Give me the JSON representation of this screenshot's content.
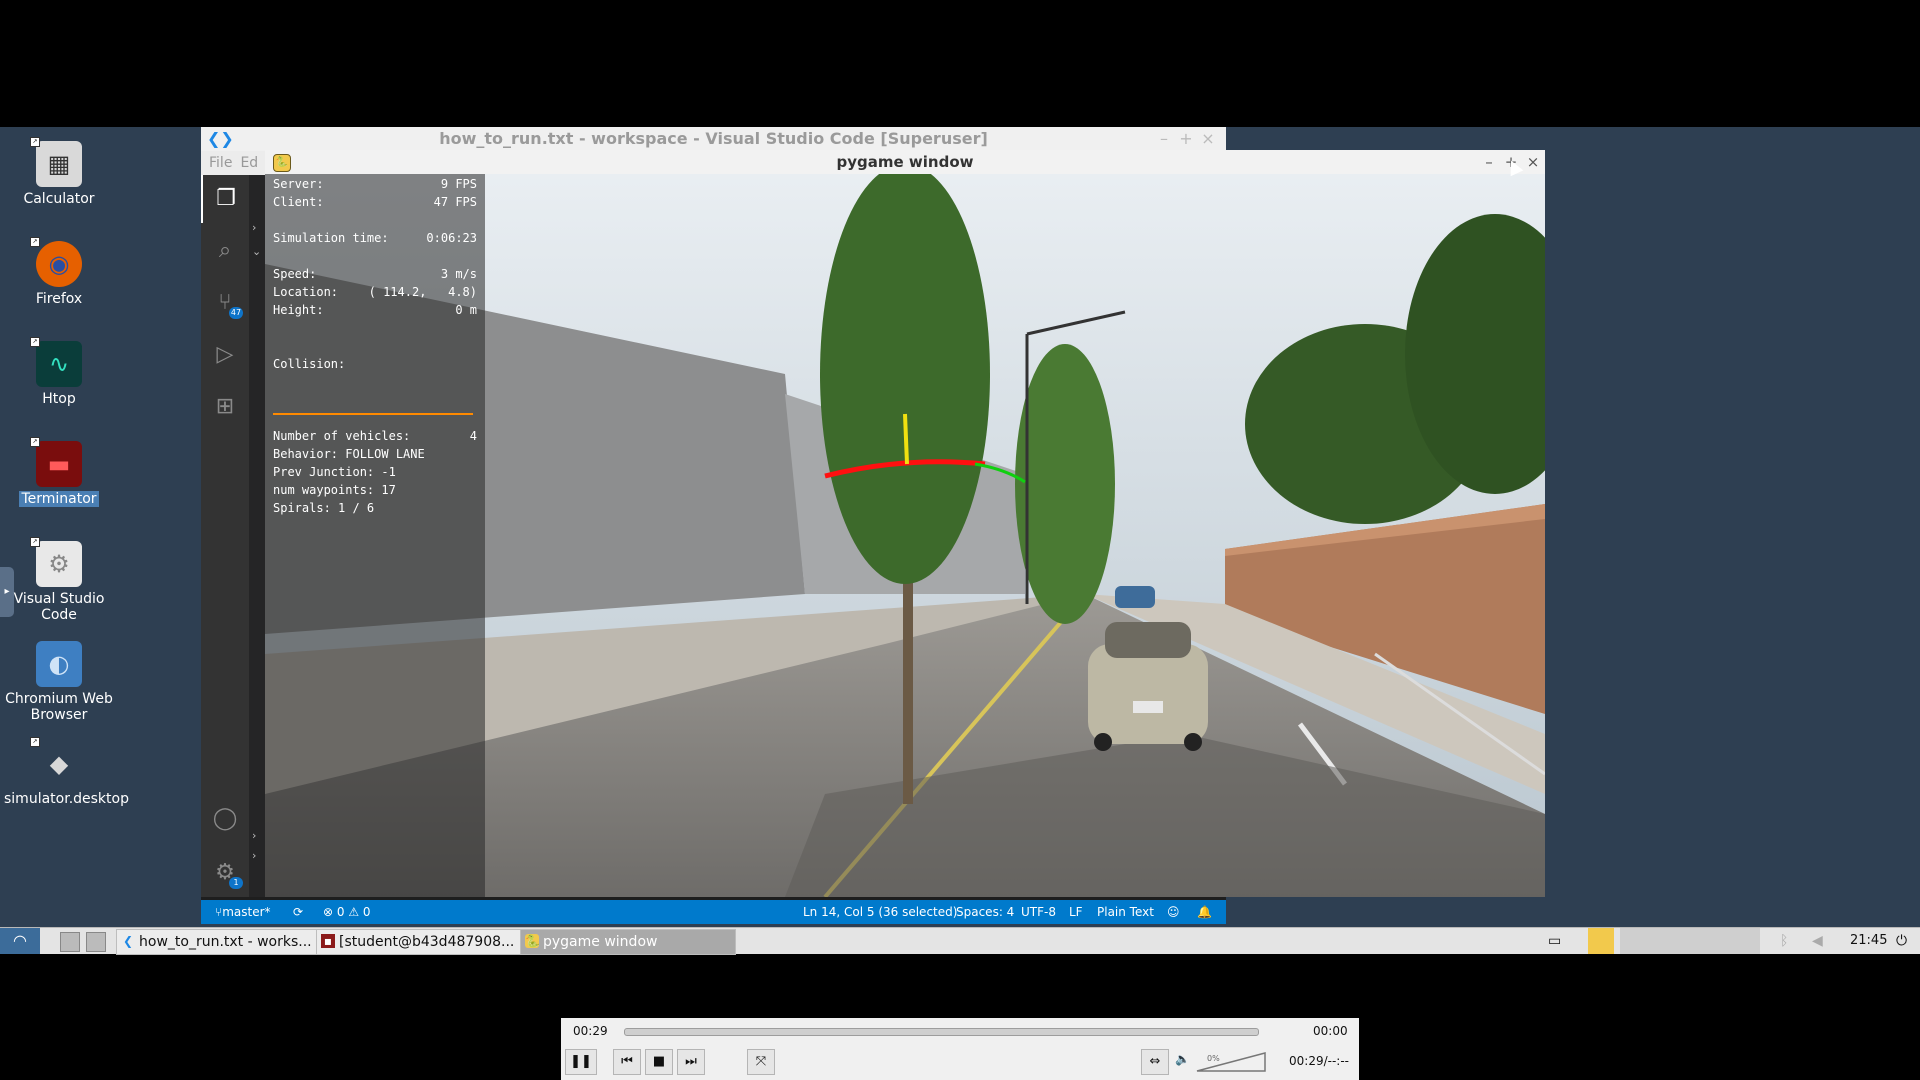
{
  "desktop": {
    "icons": [
      {
        "label": "Calculator",
        "glyph": "▦",
        "icon": "calculator-icon"
      },
      {
        "label": "Firefox",
        "glyph": "◉",
        "icon": "firefox-icon"
      },
      {
        "label": "Htop",
        "glyph": "∿",
        "icon": "htop-icon"
      },
      {
        "label": "Terminator",
        "glyph": "▬",
        "icon": "terminator-icon"
      },
      {
        "label": "Visual Studio Code",
        "glyph": "⚙",
        "icon": "vscode-desktop-icon"
      },
      {
        "label": "Chromium Web Browser",
        "glyph": "◐",
        "icon": "chromium-icon"
      },
      {
        "label": "simulator.desktop",
        "glyph": "◆",
        "icon": "simulator-icon"
      }
    ]
  },
  "vscode": {
    "title": "how_to_run.txt - workspace - Visual Studio Code [Superuser]",
    "menu": [
      "File",
      "Ed"
    ],
    "badges": {
      "scm": "47",
      "settings": "1"
    },
    "status": {
      "branch": "master*",
      "problems": "⊗ 0 ⚠ 0",
      "position": "Ln 14, Col 5 (36 selected)",
      "spaces": "Spaces: 4",
      "encoding": "UTF-8",
      "eol": "LF",
      "language": "Plain Text"
    }
  },
  "pygame": {
    "title": "pygame window",
    "hud": {
      "server_label": "Server:",
      "server_value": "9 FPS",
      "client_label": "Client:",
      "client_value": "47 FPS",
      "simtime_label": "Simulation time:",
      "simtime_value": "0:06:23",
      "speed_label": "Speed:",
      "speed_value": "3 m/s",
      "location_label": "Location:",
      "location_value": "( 114.2,   4.8)",
      "height_label": "Height:",
      "height_value": "0 m",
      "collision_label": "Collision:",
      "vehicles_label": "Number of vehicles:",
      "vehicles_value": "4",
      "behavior": "Behavior: FOLLOW LANE",
      "junction": "Prev Junction: -1",
      "waypoints": "num waypoints: 17",
      "spirals": "Spirals: 1 / 6"
    }
  },
  "taskbar": {
    "tasks": [
      {
        "label": "how_to_run.txt - works...",
        "icon": "vscode-icon"
      },
      {
        "label": "[student@b43d487908...",
        "icon": "terminal-icon"
      },
      {
        "label": "pygame window",
        "icon": "pygame-icon"
      }
    ],
    "clock": "21:45"
  },
  "player": {
    "elapsed": "00:29",
    "remaining": "00:00",
    "volume": "0%",
    "counter": "00:29/--:--"
  }
}
